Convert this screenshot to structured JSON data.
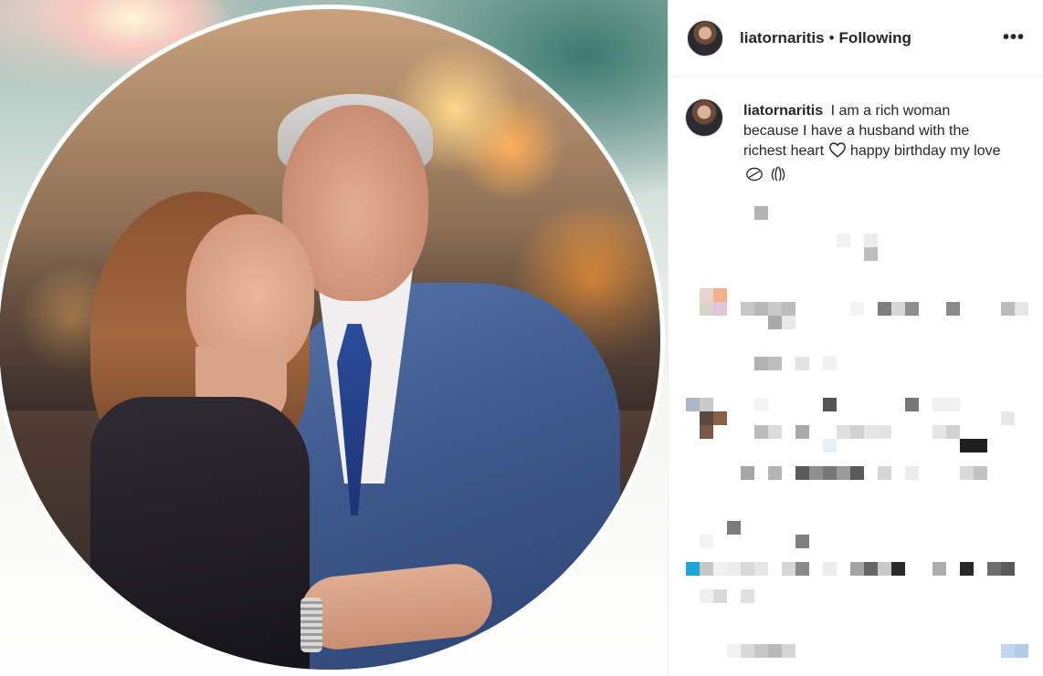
{
  "post": {
    "username": "liatornaritis",
    "separator": "•",
    "follow_status": "Following",
    "more_label": "•••"
  },
  "caption": {
    "username": "liatornaritis",
    "text_before_heart": "I am a rich woman because I have a husband with the richest heart",
    "text_after_heart": "happy birthday my love"
  },
  "icons": {
    "heart": "heart-outline-icon",
    "kiss": "kiss-emoji-icon",
    "hands": "raised-hands-emoji-icon",
    "more": "more-options-icon"
  },
  "colors": {
    "text": "#262626",
    "border": "#efefef",
    "background": "#ffffff"
  }
}
